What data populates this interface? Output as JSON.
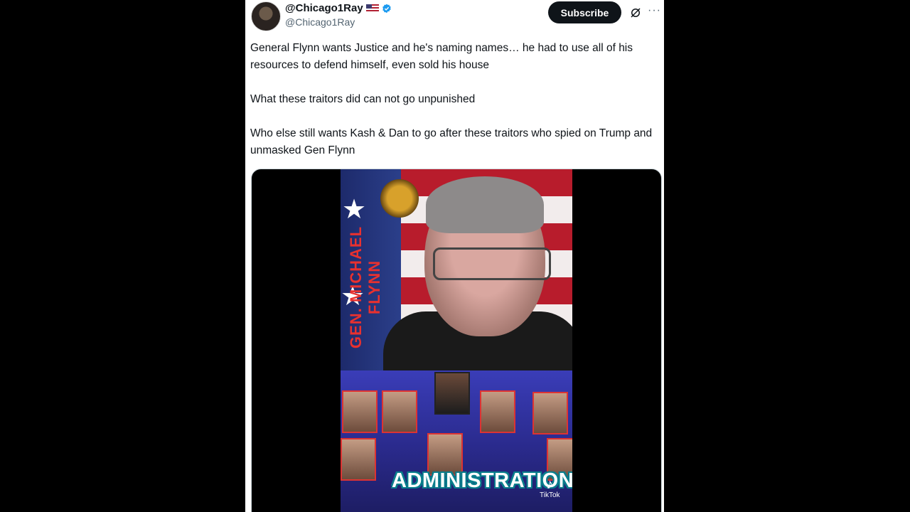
{
  "author": {
    "display_name": "@Chicago1Ray",
    "handle": "@Chicago1Ray",
    "flag": "us-flag-icon",
    "verified": true
  },
  "actions": {
    "subscribe_label": "Subscribe",
    "grok_icon": "grok-icon",
    "more_label": "···"
  },
  "tweet": {
    "paragraphs": [
      "General Flynn wants Justice and he's naming names… he had to use all of his resources to defend himself, even sold his house",
      "What these traitors did can not go unpunished",
      "Who else still wants Kash & Dan to go after these traitors who spied on Trump and unmasked Gen Flynn"
    ]
  },
  "video": {
    "name_overlay": "GEN. MICHAEL FLYNN",
    "caption": "ADMINISTRATION",
    "watermark": "TikTok"
  },
  "colors": {
    "accent": "#1d9bf0",
    "background": "#000000",
    "panel": "#ffffff",
    "text": "#0f1419",
    "muted": "#536471"
  }
}
